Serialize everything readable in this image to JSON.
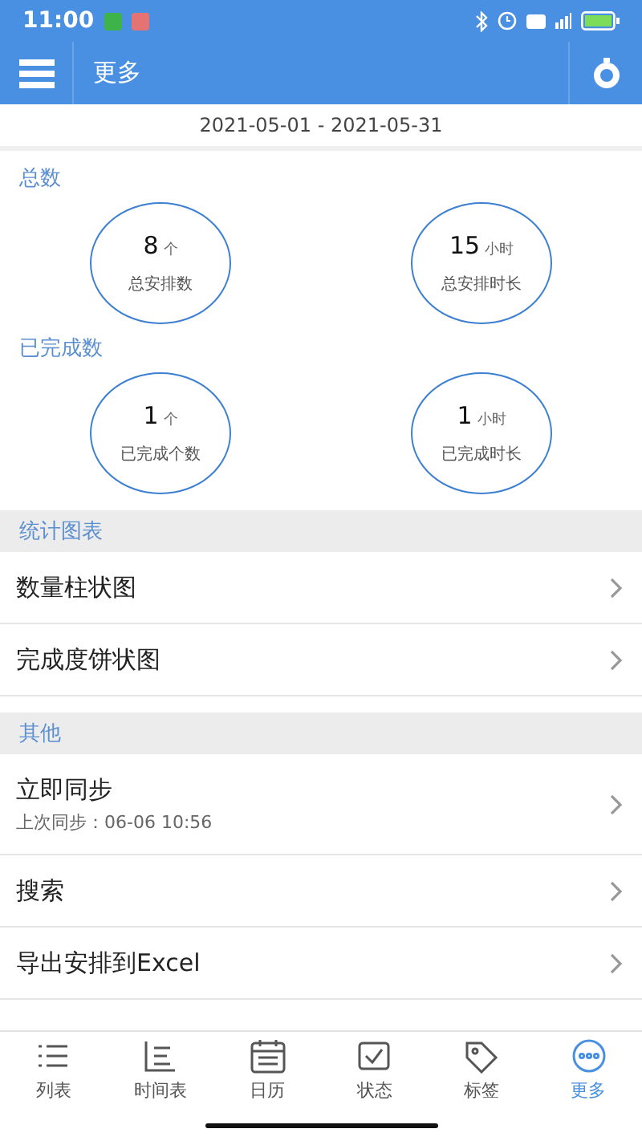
{
  "status_bar": {
    "time": "11:00"
  },
  "app_bar": {
    "title": "更多"
  },
  "date_range": "2021-05-01 - 2021-05-31",
  "stat_groups": [
    {
      "title": "总数",
      "stats": [
        {
          "value": "8",
          "unit": "个",
          "label": "总安排数"
        },
        {
          "value": "15",
          "unit": "小时",
          "label": "总安排时长"
        }
      ]
    },
    {
      "title": "已完成数",
      "stats": [
        {
          "value": "1",
          "unit": "个",
          "label": "已完成个数"
        },
        {
          "value": "1",
          "unit": "小时",
          "label": "已完成时长"
        }
      ]
    }
  ],
  "sections": [
    {
      "title": "统计图表",
      "items": [
        {
          "label": "数量柱状图"
        },
        {
          "label": "完成度饼状图"
        }
      ]
    },
    {
      "title": "其他",
      "items": [
        {
          "label": "立即同步",
          "subtitle": "上次同步：06-06 10:56"
        },
        {
          "label": "搜索"
        },
        {
          "label": "导出安排到Excel"
        }
      ]
    }
  ],
  "tabs": [
    {
      "label": "列表",
      "kind": "list",
      "selected": false
    },
    {
      "label": "时间表",
      "kind": "timeline",
      "selected": false
    },
    {
      "label": "日历",
      "kind": "calendar",
      "selected": false
    },
    {
      "label": "状态",
      "kind": "status",
      "selected": false
    },
    {
      "label": "标签",
      "kind": "tag",
      "selected": false
    },
    {
      "label": "更多",
      "kind": "more",
      "selected": true
    }
  ]
}
